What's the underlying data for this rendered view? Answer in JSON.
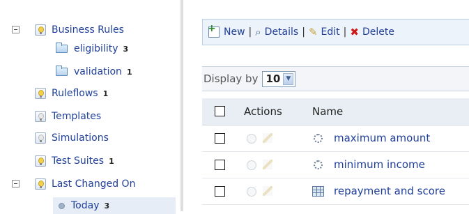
{
  "tree": {
    "items": [
      {
        "label": "Business Rules",
        "count": "",
        "icon": "bulb-icon"
      },
      {
        "label": "eligibility",
        "count": "3",
        "icon": "folder-icon"
      },
      {
        "label": "validation",
        "count": "1",
        "icon": "folder-icon"
      },
      {
        "label": "Ruleflows",
        "count": "1",
        "icon": "bulb-icon"
      },
      {
        "label": "Templates",
        "count": "",
        "icon": "bulb-icon"
      },
      {
        "label": "Simulations",
        "count": "",
        "icon": "bulb-icon"
      },
      {
        "label": "Test Suites",
        "count": "1",
        "icon": "bulb-icon"
      },
      {
        "label": "Last Changed On",
        "count": "",
        "icon": "bulb-icon"
      },
      {
        "label": "Today",
        "count": "3",
        "icon": "dot-icon"
      }
    ]
  },
  "toolbar": {
    "new_label": "New",
    "details_label": "Details",
    "edit_label": "Edit",
    "delete_label": "Delete",
    "separator": "|"
  },
  "display": {
    "label": "Display by",
    "value": "10"
  },
  "table": {
    "headers": {
      "actions": "Actions",
      "name": "Name"
    },
    "rows": [
      {
        "name": "maximum amount",
        "type_icon": "gear-icon"
      },
      {
        "name": "minimum income",
        "type_icon": "gear-icon"
      },
      {
        "name": "repayment and score",
        "type_icon": "table-icon"
      }
    ]
  },
  "colors": {
    "link": "#1f3f9a",
    "toolbar_bg": "#edf3fa",
    "selected_bg": "#e6edf7"
  }
}
